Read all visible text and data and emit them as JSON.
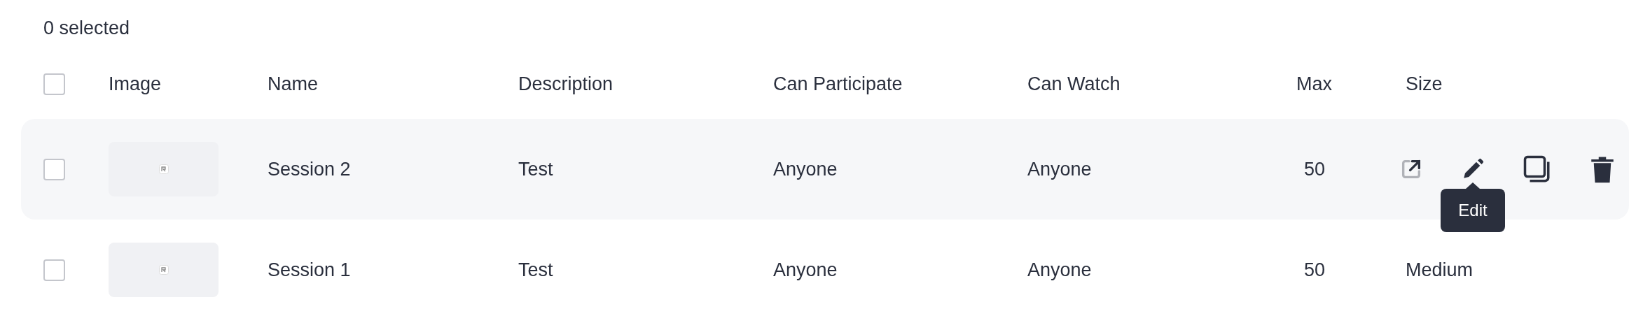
{
  "selection_count": "0 selected",
  "header": {
    "checked": false,
    "columns": [
      "Image",
      "Name",
      "Description",
      "Can Participate",
      "Can Watch",
      "Max",
      "Size"
    ]
  },
  "rows": [
    {
      "checked": false,
      "hovered": true,
      "name": "Session 2",
      "description": "Test",
      "can_participate": "Anyone",
      "can_watch": "Anyone",
      "max": "50",
      "tooltip": "Edit"
    },
    {
      "checked": false,
      "hovered": false,
      "name": "Session 1",
      "description": "Test",
      "can_participate": "Anyone",
      "can_watch": "Anyone",
      "max": "50",
      "size": "Medium"
    }
  ]
}
